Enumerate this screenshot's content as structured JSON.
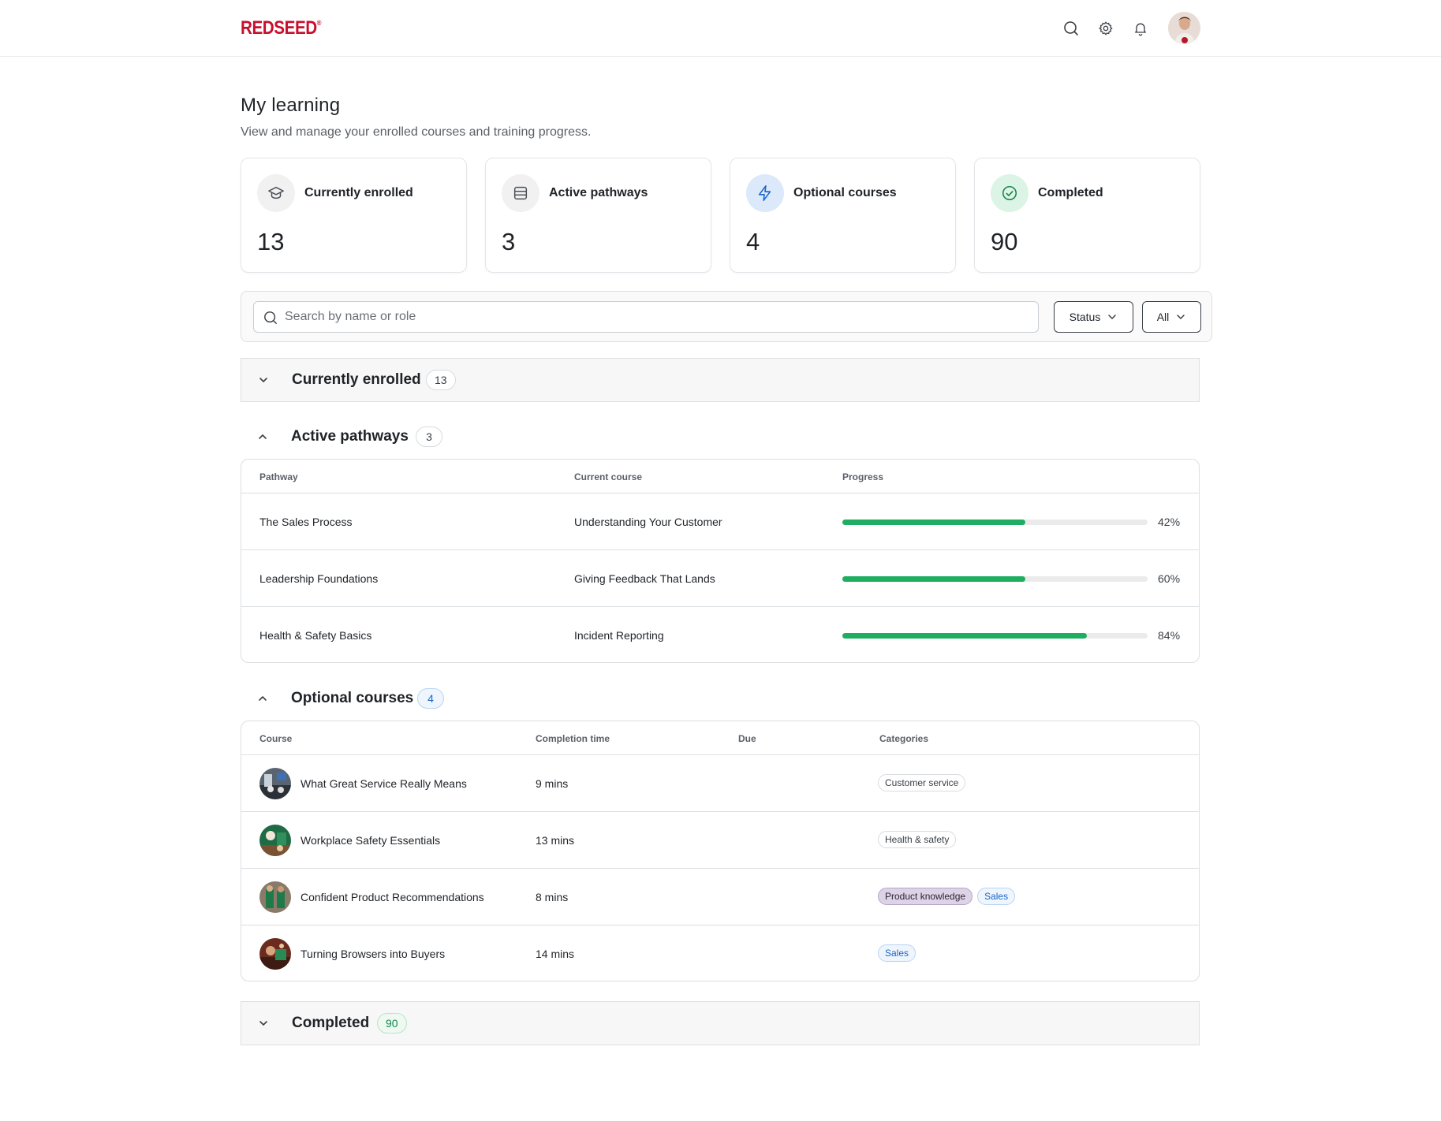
{
  "brand": {
    "logo_text": "REDSEED",
    "logo_mark": "®",
    "color": "#c8102e"
  },
  "header": {
    "icons": [
      "search-icon",
      "gear-icon",
      "bell-icon"
    ],
    "avatar": "user-avatar"
  },
  "page": {
    "title": "My learning",
    "subtitle": "View and manage your enrolled courses and training progress."
  },
  "stats": [
    {
      "label": "Currently enrolled",
      "value": "13",
      "icon": "graduation-cap-icon"
    },
    {
      "label": "Active pathways",
      "value": "3",
      "icon": "layers-icon"
    },
    {
      "label": "Optional courses",
      "value": "4",
      "icon": "lightning-icon"
    },
    {
      "label": "Completed",
      "value": "90",
      "icon": "check-circle-icon"
    }
  ],
  "filters": {
    "search_placeholder": "Search by name or role",
    "status_label": "Status",
    "all_label": "All"
  },
  "sections": {
    "enrolled": {
      "title": "Currently enrolled",
      "count": "13",
      "expanded": false
    },
    "pathways": {
      "title": "Active pathways",
      "count": "3",
      "expanded": true,
      "columns": [
        "Pathway",
        "Current course",
        "Progress"
      ],
      "rows": [
        {
          "pathway": "The Sales Process",
          "current_course": "Understanding Your Customer",
          "progress": 0.6,
          "progress_label": "42%"
        },
        {
          "pathway": "Leadership Foundations",
          "current_course": "Giving Feedback That Lands",
          "progress": 0.6,
          "progress_label": "60%"
        },
        {
          "pathway": "Health & Safety Basics",
          "current_course": "Incident Reporting",
          "progress": 0.8,
          "progress_label": "84%"
        }
      ]
    },
    "optional": {
      "title": "Optional courses",
      "count": "4",
      "expanded": true,
      "columns": [
        "Course",
        "Completion time",
        "Due",
        "Categories"
      ],
      "rows": [
        {
          "course": "What Great Service Really Means",
          "time": "9 mins",
          "due": "",
          "categories": [
            {
              "label": "Customer service",
              "style": "plain"
            }
          ]
        },
        {
          "course": "Workplace Safety Essentials",
          "time": "13 mins",
          "due": "",
          "categories": [
            {
              "label": "Health & safety",
              "style": "plain"
            }
          ]
        },
        {
          "course": "Confident Product Recommendations",
          "time": "8 mins",
          "due": "",
          "categories": [
            {
              "label": "Product knowledge",
              "style": "purple"
            },
            {
              "label": "Sales",
              "style": "blue"
            }
          ]
        },
        {
          "course": "Turning Browsers into Buyers",
          "time": "14 mins",
          "due": "",
          "categories": [
            {
              "label": "Sales",
              "style": "blue"
            }
          ]
        }
      ]
    },
    "completed": {
      "title": "Completed",
      "count": "90",
      "expanded": false
    }
  },
  "colors": {
    "progress": "#1fae61",
    "brand": "#c8102e",
    "accent_blue": "#1a66c9",
    "accent_green": "#18864b"
  }
}
